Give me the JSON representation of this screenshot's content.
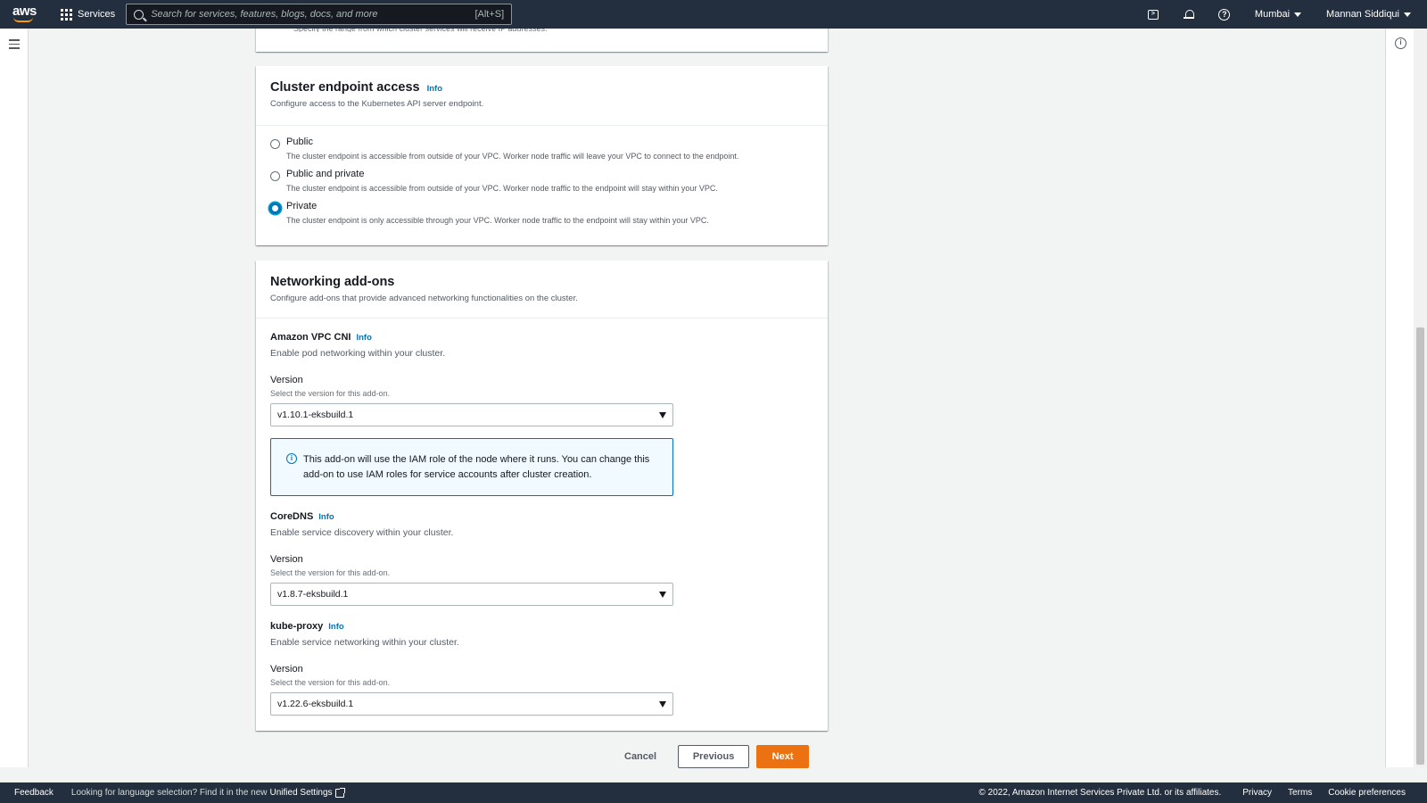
{
  "topnav": {
    "services_label": "Services",
    "search_placeholder": "Search for services, features, blogs, docs, and more",
    "search_shortcut": "[Alt+S]",
    "region": "Mumbai",
    "user": "Mannan Siddiqui"
  },
  "previous_section": {
    "description_fragment": "Specify the range from which cluster services will receive IP addresses."
  },
  "endpoint_access": {
    "title": "Cluster endpoint access",
    "info": "Info",
    "description": "Configure access to the Kubernetes API server endpoint.",
    "selected": "Private",
    "options": [
      {
        "label": "Public",
        "description": "The cluster endpoint is accessible from outside of your VPC. Worker node traffic will leave your VPC to connect to the endpoint."
      },
      {
        "label": "Public and private",
        "description": "The cluster endpoint is accessible from outside of your VPC. Worker node traffic to the endpoint will stay within your VPC."
      },
      {
        "label": "Private",
        "description": "The cluster endpoint is only accessible through your VPC. Worker node traffic to the endpoint will stay within your VPC."
      }
    ]
  },
  "networking_addons": {
    "title": "Networking add-ons",
    "description": "Configure add-ons that provide advanced networking functionalities on the cluster.",
    "version_label": "Version",
    "version_description": "Select the version for this add-on.",
    "info": "Info",
    "vpc_cni": {
      "name": "Amazon VPC CNI",
      "description": "Enable pod networking within your cluster.",
      "version": "v1.10.1-eksbuild.1",
      "notice": "This add-on will use the IAM role of the node where it runs. You can change this add-on to use IAM roles for service accounts after cluster creation."
    },
    "coredns": {
      "name": "CoreDNS",
      "description": "Enable service discovery within your cluster.",
      "version": "v1.8.7-eksbuild.1"
    },
    "kube_proxy": {
      "name": "kube-proxy",
      "description": "Enable service networking within your cluster.",
      "version": "v1.22.6-eksbuild.1"
    }
  },
  "actions": {
    "cancel": "Cancel",
    "previous": "Previous",
    "next": "Next"
  },
  "footer": {
    "feedback": "Feedback",
    "language_notice": "Looking for language selection? Find it in the new",
    "unified_settings": "Unified Settings",
    "copyright": "© 2022, Amazon Internet Services Private Ltd. or its affiliates.",
    "privacy": "Privacy",
    "terms": "Terms",
    "cookie_preferences": "Cookie preferences"
  },
  "colors": {
    "nav_bg": "#232f3e",
    "primary_button": "#ec7211",
    "link": "#0073bb",
    "logo_accent": "#ff9900"
  },
  "icons": [
    "aws-logo",
    "grid-icon",
    "search-icon",
    "cloudshell-icon",
    "bell-icon",
    "help-icon",
    "menu-icon",
    "info-icon",
    "external-link-icon"
  ]
}
